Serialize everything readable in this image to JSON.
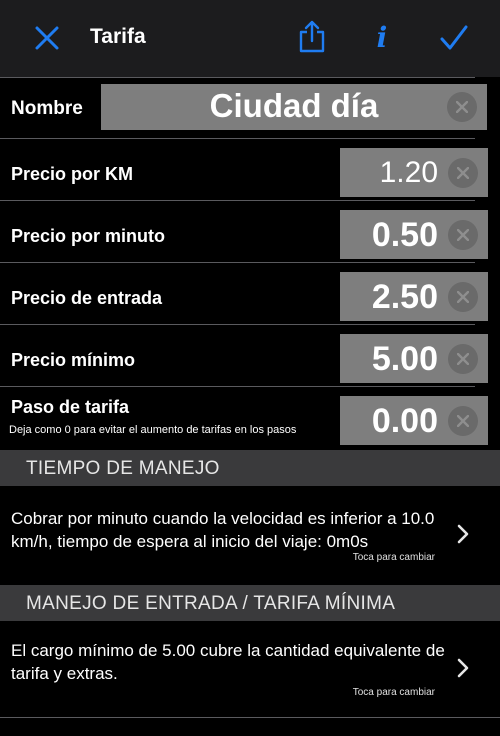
{
  "navbar": {
    "title": "Tarifa",
    "close_icon": "close-icon",
    "share_icon": "share-icon",
    "info_icon": "info-icon",
    "done_icon": "checkmark-icon",
    "info_glyph": "i",
    "accent_color": "#1f7cf1"
  },
  "fields": {
    "nombre": {
      "label": "Nombre",
      "value": "Ciudad día"
    },
    "precio_km": {
      "label": "Precio por KM",
      "value": "1.20"
    },
    "precio_minuto": {
      "label": "Precio por minuto",
      "value": "0.50"
    },
    "precio_entrada": {
      "label": "Precio de entrada",
      "value": "2.50"
    },
    "precio_minimo": {
      "label": "Precio mínimo",
      "value": "5.00"
    },
    "paso_tarifa": {
      "label": "Paso de tarifa",
      "value": "0.00",
      "hint": "Deja como 0 para evitar el aumento de tarifas en los pasos"
    }
  },
  "sections": {
    "tiempo": {
      "header": "TIEMPO DE MANEJO",
      "description": "Cobrar por minuto cuando la velocidad es inferior a 10.0 km/h, tiempo de espera al inicio del viaje: 0m0s",
      "tap_hint": "Toca para cambiar"
    },
    "entrada": {
      "header": "MANEJO DE ENTRADA / TARIFA MÍNIMA",
      "description": "El cargo mínimo de 5.00 cubre la cantidad equivalente de tarifa y extras.",
      "tap_hint": "Toca para cambiar"
    }
  }
}
